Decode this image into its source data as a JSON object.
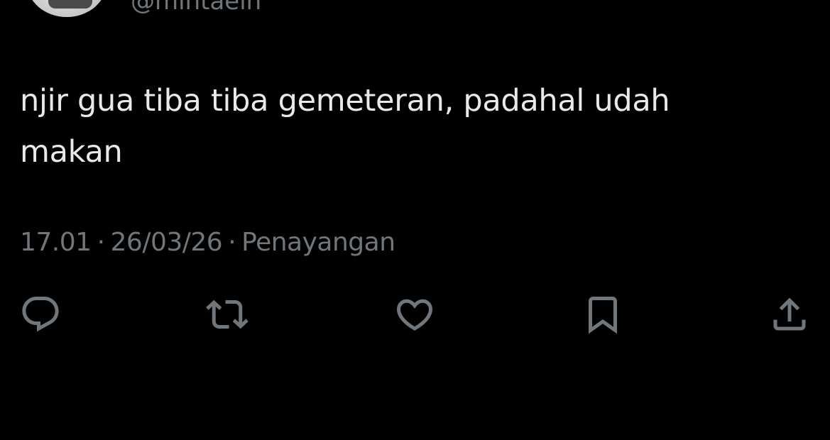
{
  "header": {
    "handle": "@mintaein"
  },
  "tweet": {
    "text": "njir gua tiba tiba gemeteran, padahal udah makan",
    "time": "17.01",
    "date": "26/03/26",
    "views_label": "Penayangan",
    "separator": "·"
  },
  "actions": [
    {
      "icon": "reply-icon"
    },
    {
      "icon": "retweet-icon"
    },
    {
      "icon": "like-icon"
    },
    {
      "icon": "bookmark-icon"
    },
    {
      "icon": "share-icon"
    }
  ],
  "colors": {
    "background": "#000000",
    "text": "#e7e9ea",
    "secondary": "#71767b"
  }
}
